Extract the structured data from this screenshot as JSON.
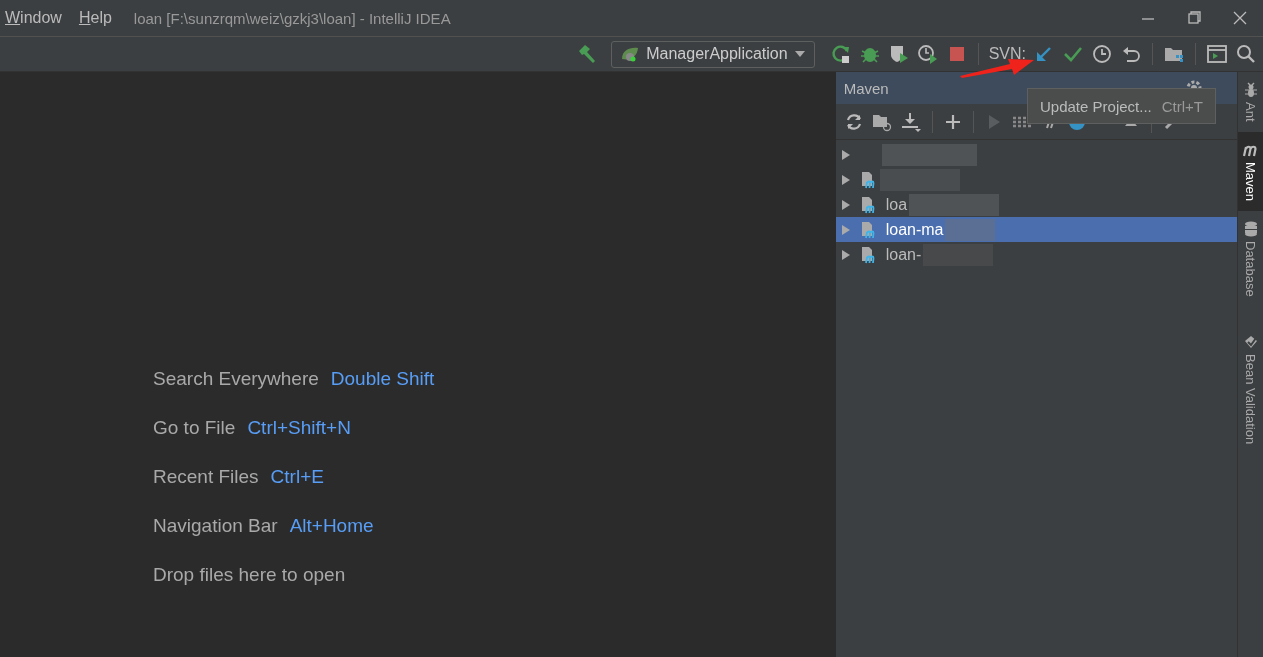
{
  "window": {
    "title": "loan [F:\\sunzrqm\\weiz\\gzkj3\\loan] - IntelliJ IDEA",
    "menu": [
      {
        "label": "Window"
      },
      {
        "label": "Help"
      }
    ]
  },
  "toolbar": {
    "run_config": "ManagerApplication",
    "svn_label": "SVN:"
  },
  "tooltip": {
    "text": "Update Project...",
    "shortcut": "Ctrl+T"
  },
  "hints": [
    {
      "label": "Search Everywhere",
      "shortcut": "Double Shift"
    },
    {
      "label": "Go to File",
      "shortcut": "Ctrl+Shift+N"
    },
    {
      "label": "Recent Files",
      "shortcut": "Ctrl+E"
    },
    {
      "label": "Navigation Bar",
      "shortcut": "Alt+Home"
    },
    {
      "label": "Drop files here to open"
    }
  ],
  "maven": {
    "title": "Maven",
    "tree": [
      {
        "kind": "blurred",
        "expanded": false,
        "selected": false
      },
      {
        "kind": "module",
        "expanded": false,
        "selected": false
      },
      {
        "kind": "module",
        "label": "loa",
        "expanded": false,
        "selected": false
      },
      {
        "kind": "module",
        "label": "loan-ma",
        "expanded": false,
        "selected": true
      },
      {
        "kind": "module",
        "label": "loan-",
        "expanded": false,
        "selected": false
      }
    ]
  },
  "side_tabs": [
    {
      "label": "Ant",
      "selected": false
    },
    {
      "label": "Maven",
      "selected": true
    },
    {
      "label": "Database",
      "selected": false
    },
    {
      "label": "Bean Validation",
      "selected": false
    }
  ]
}
